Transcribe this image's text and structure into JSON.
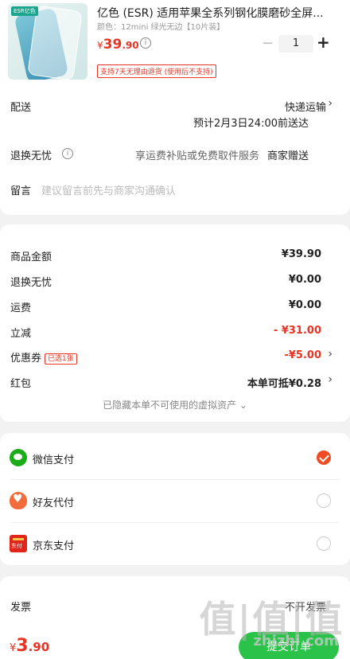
{
  "product": {
    "title": "亿色 (ESR) 适用苹果全系列钢化膜磨砂全屏...",
    "spec": "颜色：12mini 绿光无边【10片装】",
    "brand_tag": "ESR亿色",
    "price_currency": "¥",
    "price_int": "39",
    "price_dec": ".90",
    "info_icon": "ⓘ",
    "qty_minus": "−",
    "qty": "1",
    "qty_plus": "+",
    "refund_tag": "支持7天无理由退货 (使用后不支持)"
  },
  "shipping": {
    "label": "配送",
    "method": "快递运输",
    "eta": "预计2月3日24:00前送达",
    "chevron": "›"
  },
  "return_service": {
    "label": "退换无忧",
    "info_icon": "ⓘ",
    "desc": "享运费补贴或免费取件服务",
    "gift": "商家赠送"
  },
  "message": {
    "label": "留言",
    "placeholder": "建议留言前先与商家沟通确认"
  },
  "summary": {
    "goods_label": "商品金额",
    "goods_value": "¥39.90",
    "return_label": "退换无忧",
    "return_value": "¥0.00",
    "freight_label": "运费",
    "freight_value": "¥0.00",
    "discount_label": "立减",
    "discount_value": "- ¥31.00",
    "coupon_label": "优惠券",
    "coupon_tag": "已选1张",
    "coupon_value": "-¥5.00",
    "redpack_label": "红包",
    "redpack_value": "本单可抵¥0.28",
    "chevron": "›",
    "hidden_note": "已隐藏本单不可使用的虚拟资产 ⌄"
  },
  "payment": {
    "options": [
      {
        "label": "微信支付",
        "icon": "wechat-pay-icon",
        "selected": true
      },
      {
        "label": "好友代付",
        "icon": "friend-pay-icon",
        "selected": false
      },
      {
        "label": "京东支付",
        "icon": "jd-pay-icon",
        "selected": false
      }
    ]
  },
  "footer": {
    "invoice_label": "发票",
    "invoice_value": "不开发票",
    "total_currency": "¥",
    "total_int": "3",
    "total_dec": ".90",
    "submit_label": "提交订单"
  },
  "watermark": {
    "text": "值|值|值",
    "site": "zhizhi.com"
  },
  "colors": {
    "accent_red": "#e93323",
    "wechat_green": "#1aad19",
    "submit_green": "#2bc24a",
    "selected_orange": "#f04b23"
  }
}
